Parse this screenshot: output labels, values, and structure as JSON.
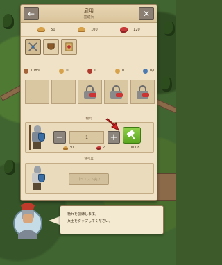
{
  "header": {
    "title": "雇用",
    "subtitle": "基礎兵",
    "back_icon": "back-arrow-icon",
    "close_icon": "close-x-icon"
  },
  "resources": [
    {
      "icon": "bread-icon",
      "value": "50"
    },
    {
      "icon": "bread-icon",
      "value": "100"
    },
    {
      "icon": "meat-icon",
      "value": "120"
    }
  ],
  "tabs": [
    {
      "icon": "swords-icon",
      "active": true
    },
    {
      "icon": "shield-helmet-icon",
      "active": false
    },
    {
      "icon": "scroll-icon",
      "active": false
    }
  ],
  "stats": [
    {
      "icon": "people-icon",
      "value": "108%"
    },
    {
      "icon": "bread-icon",
      "value": "0"
    },
    {
      "icon": "crossed-swords-icon",
      "value": "0"
    },
    {
      "icon": "bread-icon",
      "value": "0"
    },
    {
      "icon": "soldier-icon",
      "value": "0/0"
    }
  ],
  "queue_slots": [
    {
      "locked": false
    },
    {
      "locked": false
    },
    {
      "locked": true
    },
    {
      "locked": true
    },
    {
      "locked": true
    }
  ],
  "unit_row_1": {
    "section_label": "槍兵",
    "quantity": "1",
    "minus_label": "−",
    "plus_label": "+",
    "cost_bread": "30",
    "cost_meat": "2",
    "time": "00:08"
  },
  "unit_row_2": {
    "section_label": "弩弓兵",
    "locked_label": "ゴミエスト完了"
  },
  "dialog": {
    "line1": "槍兵を訓練します。",
    "line2": "兵士をタップしてください。"
  },
  "colors": {
    "panel": "#efe2c6",
    "train_button": "#6cb82a",
    "arrow": "#d42020"
  }
}
